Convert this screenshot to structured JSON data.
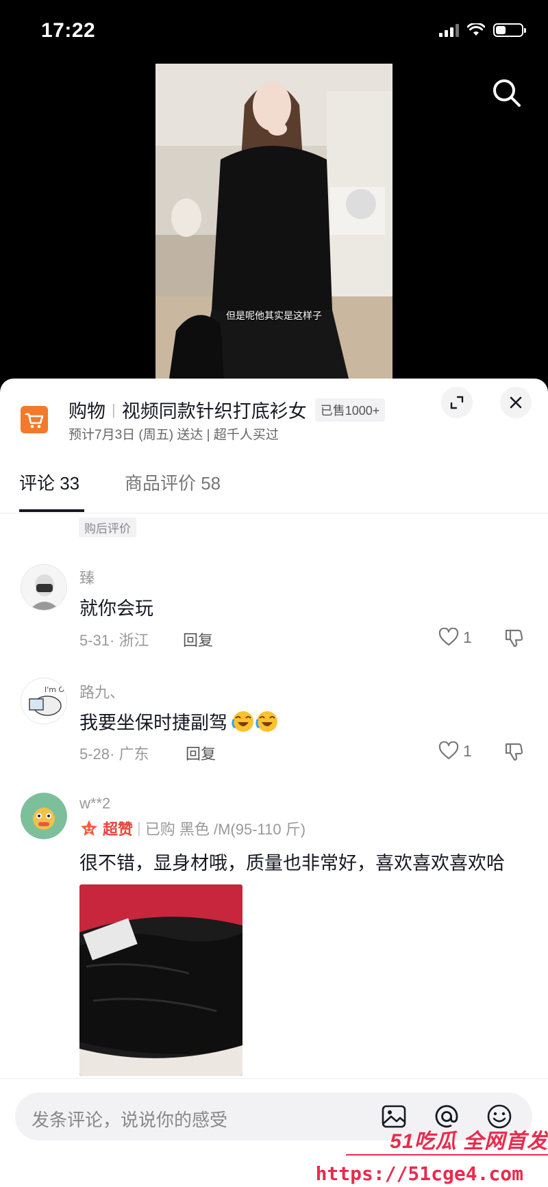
{
  "status_bar": {
    "time": "17:22"
  },
  "video": {
    "caption": "但是呢他其实是这样子"
  },
  "product": {
    "category": "购物",
    "title": "视频同款针织打底衫女",
    "sold": "已售1000+",
    "delivery": "预计7月3日 (周五) 送达 | 超千人买过"
  },
  "tabs": [
    {
      "label": "评论 33"
    },
    {
      "label": "商品评价 58"
    }
  ],
  "after_purchase_label": "购后评价",
  "comments": [
    {
      "user": "臻",
      "text": "就你会玩",
      "meta": "5-31· 浙江",
      "reply": "回复",
      "likes": "1"
    },
    {
      "user": "路九、",
      "text": "我要坐保时捷副驾",
      "meta": "5-28· 广东",
      "reply": "回复",
      "likes": "1",
      "emoji": "laughing-crying"
    },
    {
      "user": "w**2",
      "badge": "超赞",
      "purchase": "已购 黑色 /M(95-110 斤)",
      "text": "很不错，显身材哦，质量也非常好，喜欢喜欢喜欢哈"
    }
  ],
  "input": {
    "placeholder": "发条评论，说说你的感受"
  },
  "watermark": {
    "brand": "51吃瓜 全网首发",
    "url": "https://51cge4.com"
  },
  "colors": {
    "accent": "#f27a2a",
    "brand_red": "#ea2a4c",
    "text": "#161823"
  }
}
